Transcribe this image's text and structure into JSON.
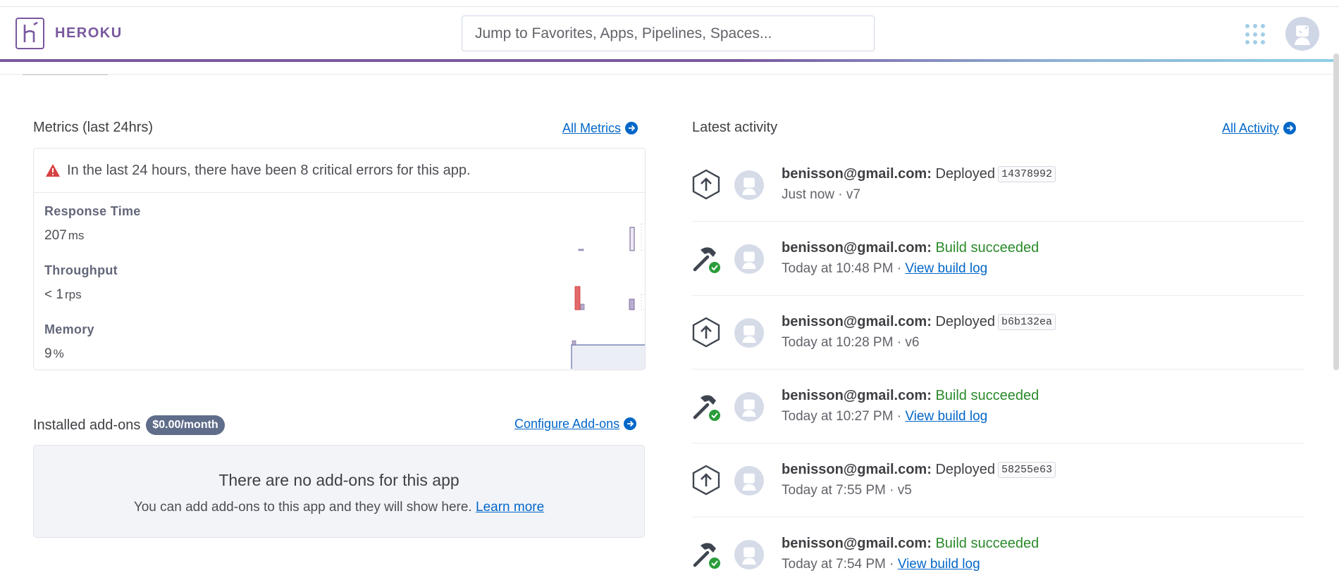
{
  "header": {
    "brand": "HEROKU",
    "search_placeholder": "Jump to Favorites, Apps, Pipelines, Spaces..."
  },
  "metrics": {
    "title": "Metrics (last 24hrs)",
    "all_link": "All Metrics",
    "alert": "In the last 24 hours, there have been 8 critical errors for this app.",
    "items": [
      {
        "label": "Response Time",
        "value": "207",
        "unit": "ms"
      },
      {
        "label": "Throughput",
        "value": "< 1",
        "unit": "rps"
      },
      {
        "label": "Memory",
        "value": "9",
        "unit": "%"
      }
    ]
  },
  "addons": {
    "title": "Installed add-ons",
    "badge": "$0.00/month",
    "configure_link": "Configure Add-ons",
    "empty_heading": "There are no add-ons for this app",
    "empty_text": "You can add add-ons to this app and they will show here.",
    "learn_more": "Learn more"
  },
  "activity": {
    "title": "Latest activity",
    "all_link": "All Activity",
    "items": [
      {
        "user": "benisson@gmail.com:",
        "action": "Deployed",
        "sha": "14378992",
        "time": "Just now · v7"
      },
      {
        "user": "benisson@gmail.com:",
        "action": "Build succeeded",
        "time": "Today at 10:48 PM ·",
        "link": "View build log"
      },
      {
        "user": "benisson@gmail.com:",
        "action": "Deployed",
        "sha": "b6b132ea",
        "time": "Today at 10:28 PM · v6"
      },
      {
        "user": "benisson@gmail.com:",
        "action": "Build succeeded",
        "time": "Today at 10:27 PM ·",
        "link": "View build log"
      },
      {
        "user": "benisson@gmail.com:",
        "action": "Deployed",
        "sha": "58255e63",
        "time": "Today at 7:55 PM · v5"
      },
      {
        "user": "benisson@gmail.com:",
        "action": "Build succeeded",
        "time": "Today at 7:54 PM ·",
        "link": "View build log"
      }
    ]
  },
  "colors": {
    "brand": "#79589f",
    "link": "#0367c9",
    "success": "#2a8a2a",
    "error": "#d64242",
    "badge": "#5f6d8a"
  }
}
